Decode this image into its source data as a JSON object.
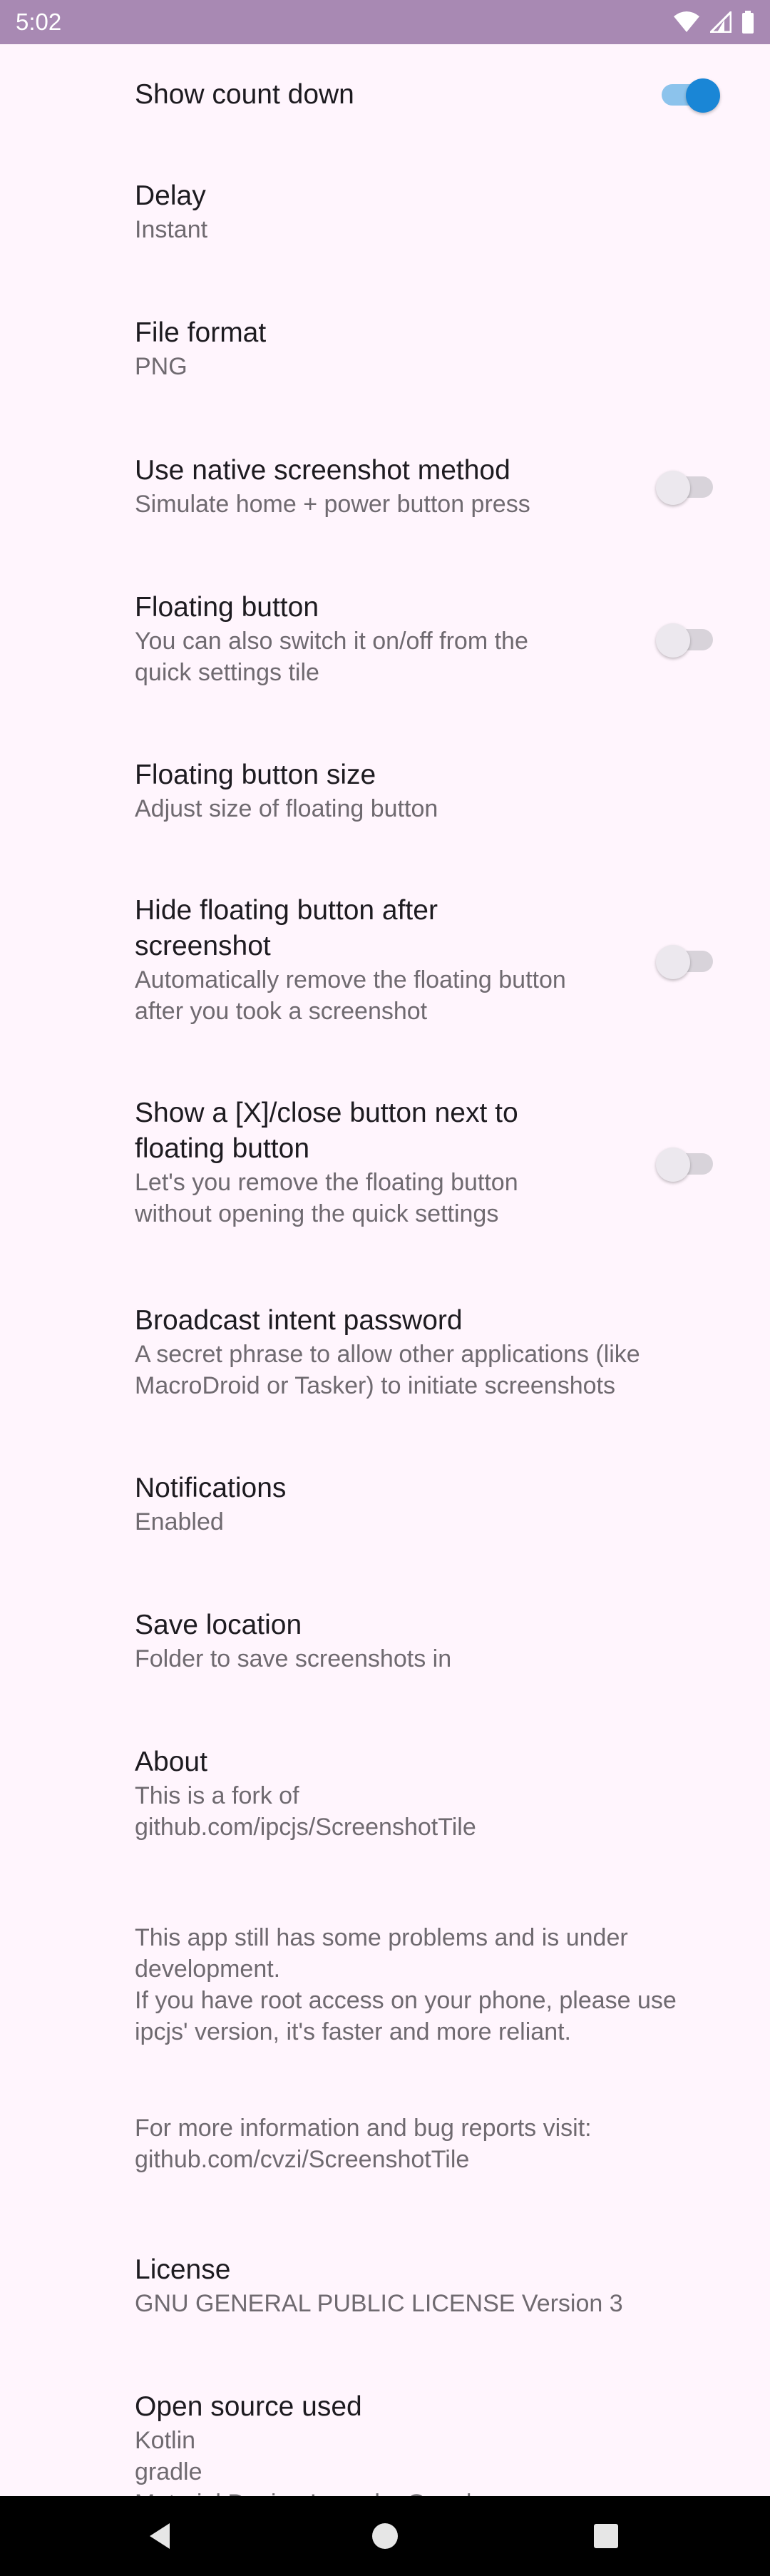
{
  "status_bar": {
    "time": "5:02",
    "icons": [
      "wifi-icon",
      "cellular-signal-icon",
      "battery-icon"
    ],
    "color": "#A889B3"
  },
  "colors": {
    "background": "#FFF5FD",
    "accent": "#1A86D6",
    "title_text": "#1D1B20",
    "summary_text": "#6F6A70"
  },
  "preferences": [
    {
      "title": "Show count down",
      "switch": true,
      "checked": true
    },
    {
      "title": "Delay",
      "summary": "Instant"
    },
    {
      "title": "File format",
      "summary": "PNG"
    },
    {
      "title": "Use native screenshot method",
      "summary": "Simulate home + power button press",
      "switch": true,
      "checked": false
    },
    {
      "title": "Floating button",
      "summary": "You can also switch it on/off from the\nquick settings tile",
      "switch": true,
      "checked": false
    },
    {
      "title": "Floating button size",
      "summary": "Adjust size of floating button"
    },
    {
      "title": "Hide floating button after\nscreenshot",
      "summary": "Automatically remove the floating button\nafter you took a screenshot",
      "switch": true,
      "checked": false
    },
    {
      "title": "Show a [X]/close button next to\nfloating button",
      "summary": "Let's you remove the floating button\nwithout opening the quick settings",
      "switch": true,
      "checked": false
    },
    {
      "title": "Broadcast intent password",
      "summary": "A secret phrase to allow other applications (like\nMacroDroid or Tasker) to initiate screenshots"
    },
    {
      "title": "Notifications",
      "summary": "Enabled"
    },
    {
      "title": "Save location",
      "summary": "Folder to save screenshots in"
    },
    {
      "title": "About",
      "summary": "This is a fork of\ngithub.com/ipcjs/ScreenshotTile"
    },
    {
      "summary": "This app still has some problems and is under\ndevelopment.\nIf you have root access on your phone, please use\nipcjs' version, it's faster and more reliant."
    },
    {
      "summary": "For more information and bug reports visit:\ngithub.com/cvzi/ScreenshotTile"
    },
    {
      "title": "License",
      "summary": "GNU GENERAL PUBLIC LICENSE Version 3"
    },
    {
      "title": "Open source used",
      "summary": "Kotlin\ngradle\nMaterial Design Icons by Google"
    }
  ],
  "nav_bar": {
    "buttons": [
      "back-icon",
      "home-icon",
      "recents-icon"
    ]
  }
}
